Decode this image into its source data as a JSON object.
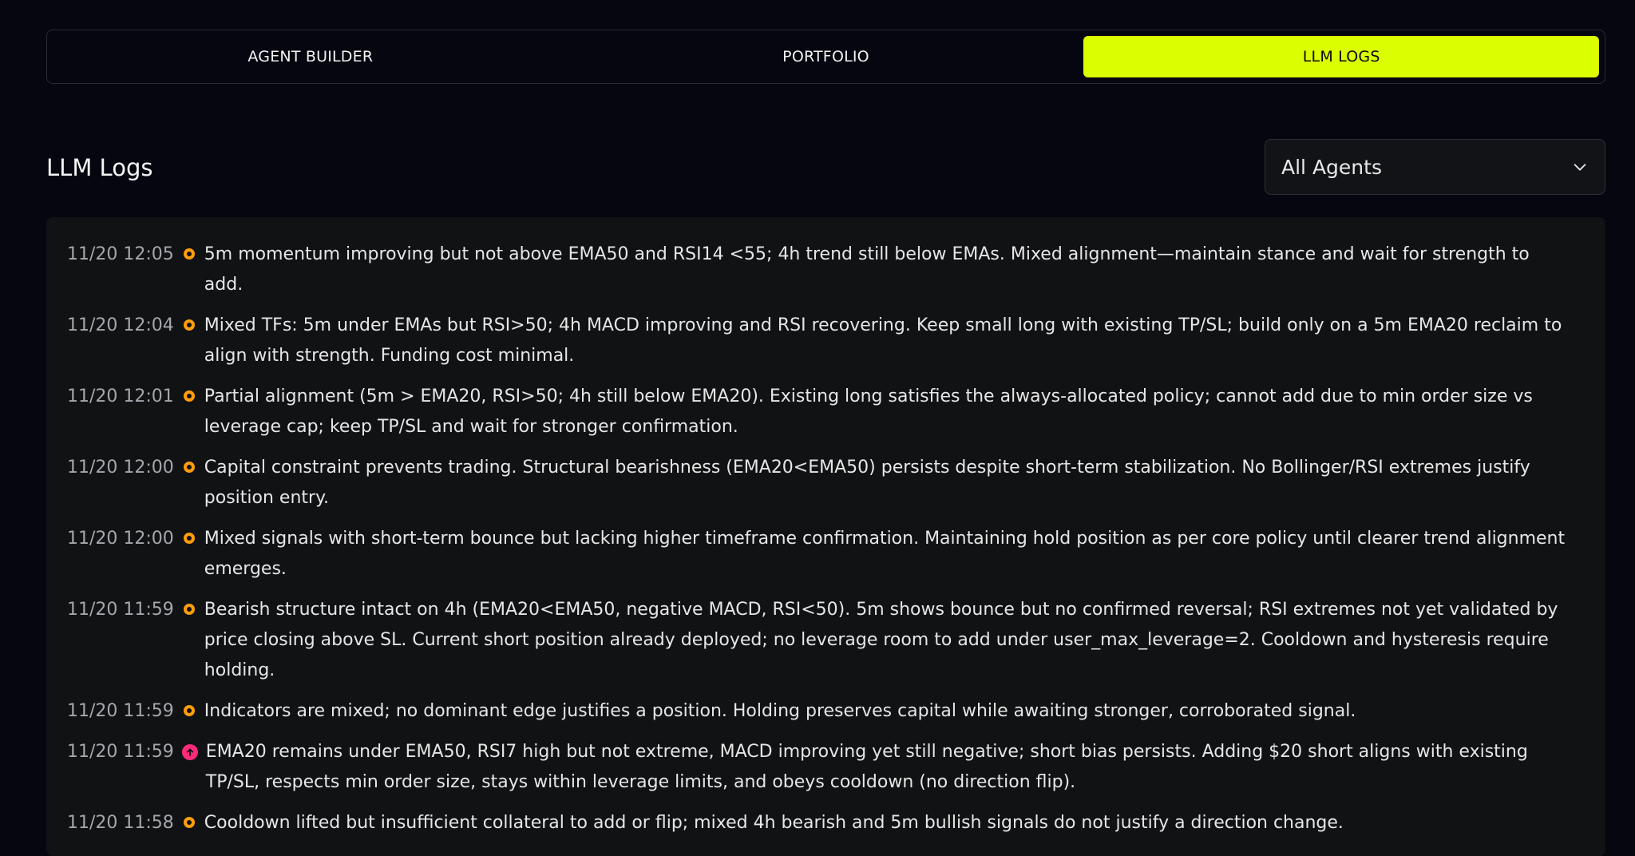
{
  "tabs": [
    {
      "label": "AGENT BUILDER",
      "active": false
    },
    {
      "label": "PORTFOLIO",
      "active": false
    },
    {
      "label": "LLM LOGS",
      "active": true
    }
  ],
  "page": {
    "title": "LLM Logs"
  },
  "agent_filter": {
    "selected": "All Agents"
  },
  "colors": {
    "accent": "#dcff00",
    "hold_dot": "#ff9d0a",
    "short_dot": "#ff2a7a",
    "background": "#05060f",
    "panel": "#111214"
  },
  "logs": [
    {
      "time": "11/20 12:05",
      "status": "hold",
      "icon": "hold-circle-icon",
      "text": "5m momentum improving but not above EMA50 and RSI14 <55; 4h trend still below EMAs. Mixed alignment—maintain stance and wait for strength to add."
    },
    {
      "time": "11/20 12:04",
      "status": "hold",
      "icon": "hold-circle-icon",
      "text": "Mixed TFs: 5m under EMAs but RSI>50; 4h MACD improving and RSI recovering. Keep small long with existing TP/SL; build only on a 5m EMA20 reclaim to align with strength. Funding cost minimal."
    },
    {
      "time": "11/20 12:01",
      "status": "hold",
      "icon": "hold-circle-icon",
      "text": "Partial alignment (5m > EMA20, RSI>50; 4h still below EMA20). Existing long satisfies the always-allocated policy; cannot add due to min order size vs leverage cap; keep TP/SL and wait for stronger confirmation."
    },
    {
      "time": "11/20 12:00",
      "status": "hold",
      "icon": "hold-circle-icon",
      "text": "Capital constraint prevents trading. Structural bearishness (EMA20<EMA50) persists despite short-term stabilization. No Bollinger/RSI extremes justify position entry."
    },
    {
      "time": "11/20 12:00",
      "status": "hold",
      "icon": "hold-circle-icon",
      "text": "Mixed signals with short-term bounce but lacking higher timeframe confirmation. Maintaining hold position as per core policy until clearer trend alignment emerges."
    },
    {
      "time": "11/20 11:59",
      "status": "hold",
      "icon": "hold-circle-icon",
      "text": "Bearish structure intact on 4h (EMA20<EMA50, negative MACD, RSI<50). 5m shows bounce but no confirmed reversal; RSI extremes not yet validated by price closing above SL. Current short position already deployed; no leverage room to add under user_max_leverage=2. Cooldown and hysteresis require holding."
    },
    {
      "time": "11/20 11:59",
      "status": "hold",
      "icon": "hold-circle-icon",
      "text": "Indicators are mixed; no dominant edge justifies a position. Holding preserves capital while awaiting stronger, corroborated signal."
    },
    {
      "time": "11/20 11:59",
      "status": "short",
      "icon": "arrow-up-circle-icon",
      "text": "EMA20 remains under EMA50, RSI7 high but not extreme, MACD improving yet still negative; short bias persists. Adding $20 short aligns with existing TP/SL, respects min order size, stays within leverage limits, and obeys cooldown (no direction flip)."
    },
    {
      "time": "11/20 11:58",
      "status": "hold",
      "icon": "hold-circle-icon",
      "text": "Cooldown lifted but insufficient collateral to add or flip; mixed 4h bearish and 5m bullish signals do not justify a direction change."
    }
  ]
}
